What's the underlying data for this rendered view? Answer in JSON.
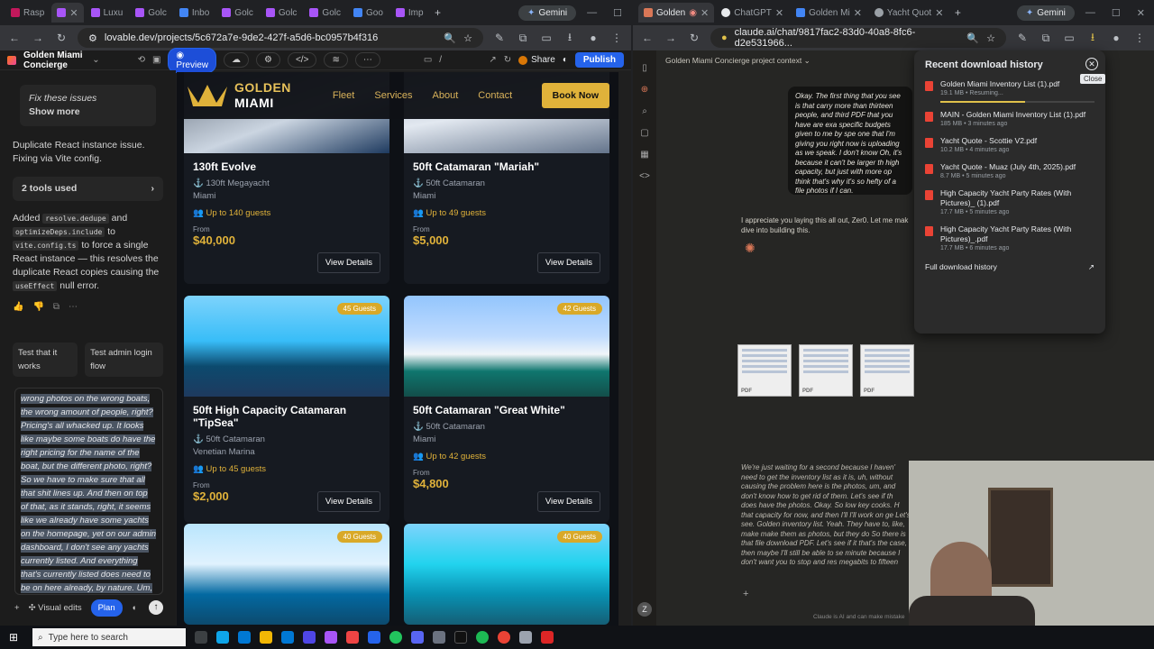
{
  "left_window": {
    "tabs": [
      {
        "label": "Rasp",
        "color": "#c2185b"
      },
      {
        "label": "",
        "color": "#a855f7",
        "active": true
      },
      {
        "label": "Luxu",
        "color": "#a855f7"
      },
      {
        "label": "Golc",
        "color": "#a855f7"
      },
      {
        "label": "Inbo",
        "color": "#4285f4"
      },
      {
        "label": "Golc",
        "color": "#a855f7"
      },
      {
        "label": "Golc",
        "color": "#a855f7"
      },
      {
        "label": "Golc",
        "color": "#a855f7"
      },
      {
        "label": "Goo",
        "color": "#4285f4"
      },
      {
        "label": "Imp",
        "color": "#a855f7"
      }
    ],
    "gemini_label": "Gemini",
    "url": "lovable.dev/projects/5c672a7e-9de2-427f-a5d6-bc0957b4f316",
    "app": {
      "project_name": "Golden Miami Concierge",
      "preview_label": "Preview",
      "path": "/",
      "share_label": "Share",
      "publish_label": "Publish"
    },
    "chat": {
      "fix_title": "Fix these issues",
      "show_more": "Show more",
      "message1": "Duplicate React instance issue. Fixing via Vite config.",
      "tools_used": "2 tools used",
      "added": "Added",
      "code1": "resolve.dedupe",
      "and": "and",
      "code2": "optimizeDeps.include",
      "to": "to",
      "code3": "vite.config.ts",
      "rest1": "to force a single React instance — this resolves the duplicate React copies causing the",
      "code4": "useEffect",
      "rest2": "null error.",
      "suggest1": "Test that it works",
      "suggest2": "Test admin login flow",
      "draft": "wrong photos on the wrong boats, the wrong amount of people, right? Pricing's all whacked up. It looks like maybe some boats do have the right pricing for the name of the boat, but the different photo, right? So we have to make sure that all that shit lines up. And then on top of that, as it stands, right, it seems like we already have some yachts on the homepage, yet on our admin dashboard, I don't see any yachts currently listed. And everything that's currently listed does need to be on here already, by nature. Um, yeah.",
      "visual_edits": "Visual edits",
      "plan": "Plan"
    },
    "site": {
      "brand_line1": "GOLDEN",
      "brand_line2": "MIAMI",
      "nav": [
        "Fleet",
        "Services",
        "About",
        "Contact"
      ],
      "book": "Book Now",
      "from_label": "From",
      "view_details": "View Details",
      "cards": [
        {
          "name": "130ft Evolve",
          "type": "130ft Megayacht",
          "location": "Miami",
          "guests": "Up to 140 guests",
          "price": "$40,000",
          "badge": ""
        },
        {
          "name": "50ft Catamaran \"Mariah\"",
          "type": "50ft Catamaran",
          "location": "Miami",
          "guests": "Up to 49 guests",
          "price": "$5,000",
          "badge": ""
        },
        {
          "name": "50ft High Capacity Catamaran \"TipSea\"",
          "type": "50ft Catamaran",
          "location": "Venetian Marina",
          "guests": "Up to 45 guests",
          "price": "$2,000",
          "badge": "45 Guests"
        },
        {
          "name": "50ft Catamaran \"Great White\"",
          "type": "50ft Catamaran",
          "location": "Miami",
          "guests": "Up to 42 guests",
          "price": "$4,800",
          "badge": "42 Guests"
        },
        {
          "name": "",
          "type": "",
          "location": "",
          "guests": "",
          "price": "",
          "badge": "40 Guests"
        },
        {
          "name": "",
          "type": "",
          "location": "",
          "guests": "",
          "price": "",
          "badge": "40 Guests"
        }
      ]
    }
  },
  "right_window": {
    "tabs": [
      {
        "label": "Golden",
        "color": "#d97757",
        "active": true
      },
      {
        "label": "ChatGPT",
        "color": "#e8eaed"
      },
      {
        "label": "Golden Mi",
        "color": "#4285f4"
      },
      {
        "label": "Yacht Quot",
        "color": "#e8eaed"
      }
    ],
    "gemini_label": "Gemini",
    "url": "claude.ai/chat/9817fac2-83d0-40a8-8fc6-d2e531966...",
    "project_context": "Golden Miami Concierge project context",
    "user_msg": "Okay. The first thing that you see is that carry more than thirteen people, and third PDF that you have are exa specific budgets given to me by spe one that I'm giving you right now is uploading as we speak. I don't know Oh, it's because it can't be larger th high capacity, but just with more op think that's why it's so hefty of a file photos if I can.",
    "assistant_msg": "I appreciate you laying this all out, Zer0. Let me mak dive into building this.",
    "draft_msg": "We're just waiting for a second because I haven' need to get the inventory list as it is, uh, without causing the problem here is the photos, um, and don't know how to get rid of them. Let's see if th does have the photos. Okay. So low key cooks. H that capacity for now, and then I'll I'll work on ge Let's see. Golden inventory list. Yeah. They have to, like, make make them as photos, but they do So there is that file download PDF. Let's see if it that's the case, then maybe I'll still be able to se minute because I don't want you to stop and res megabits to fifteen",
    "disclaimer": "Claude is AI and can make mistake",
    "thumb_label": "PDF",
    "downloads": {
      "title": "Recent download history",
      "close_tip": "Close",
      "full_history": "Full download history",
      "items": [
        {
          "name": "Golden Miami Inventory List (1).pdf",
          "meta": "19.1 MB • Resuming...",
          "progress": 0.55
        },
        {
          "name": "MAIN - Golden Miami Inventory List (1).pdf",
          "meta": "185 MB • 3 minutes ago"
        },
        {
          "name": "Yacht Quote - Scottie V2.pdf",
          "meta": "10.2 MB • 4 minutes ago"
        },
        {
          "name": "Yacht Quote - Muaz (July 4th, 2025).pdf",
          "meta": "8.7 MB • 5 minutes ago"
        },
        {
          "name": "High Capacity Yacht Party Rates (With Pictures)_ (1).pdf",
          "meta": "17.7 MB • 5 minutes ago"
        },
        {
          "name": "High Capacity Yacht Party Rates (With Pictures)_.pdf",
          "meta": "17.7 MB • 6 minutes ago"
        }
      ]
    }
  },
  "taskbar": {
    "search_placeholder": "Type here to search"
  }
}
